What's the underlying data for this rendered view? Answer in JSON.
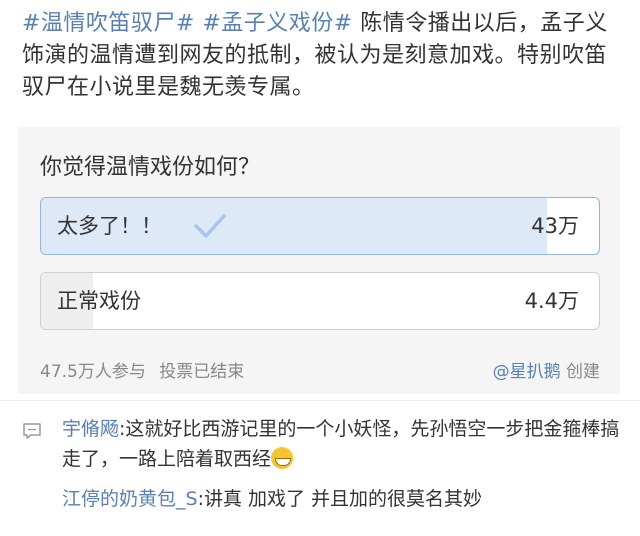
{
  "post": {
    "tags": [
      "#温情吹笛驭尸#",
      "#孟子义戏份#"
    ],
    "text": " 陈情令播出以后，孟子义饰演的温情遭到网友的抵制，被认为是刻意加戏。特别吹笛驭尸在小说里是魏无羡专属。"
  },
  "poll": {
    "question": "你觉得温情戏份如何？",
    "options": [
      {
        "label": "太多了！！",
        "count": "43万",
        "fraction": 0.907,
        "selected": true
      },
      {
        "label": "正常戏份",
        "count": "4.4万",
        "fraction": 0.093,
        "selected": false
      }
    ],
    "participants": "47.5万人参与",
    "status": "投票已结束",
    "creator": "@星扒鹅",
    "creator_suffix": "创建"
  },
  "comments": [
    {
      "user": "宇脩飏",
      "text": ":这就好比西游记里的一个小妖怪，先孙悟空一步把金箍棒搞走了，一路上陪着取西经",
      "emoji": "grin-emoji"
    },
    {
      "user": "江停的奶黄包_S",
      "text": ":讲真  加戏了  并且加的很莫名其妙"
    }
  ],
  "colors": {
    "link": "#5a7fb5",
    "selected_fill": "#dde9f7",
    "selected_border": "#8fb6e3",
    "check": "#a9c6ea"
  },
  "icons": [
    "check-icon",
    "comment-icon",
    "grin-emoji"
  ]
}
